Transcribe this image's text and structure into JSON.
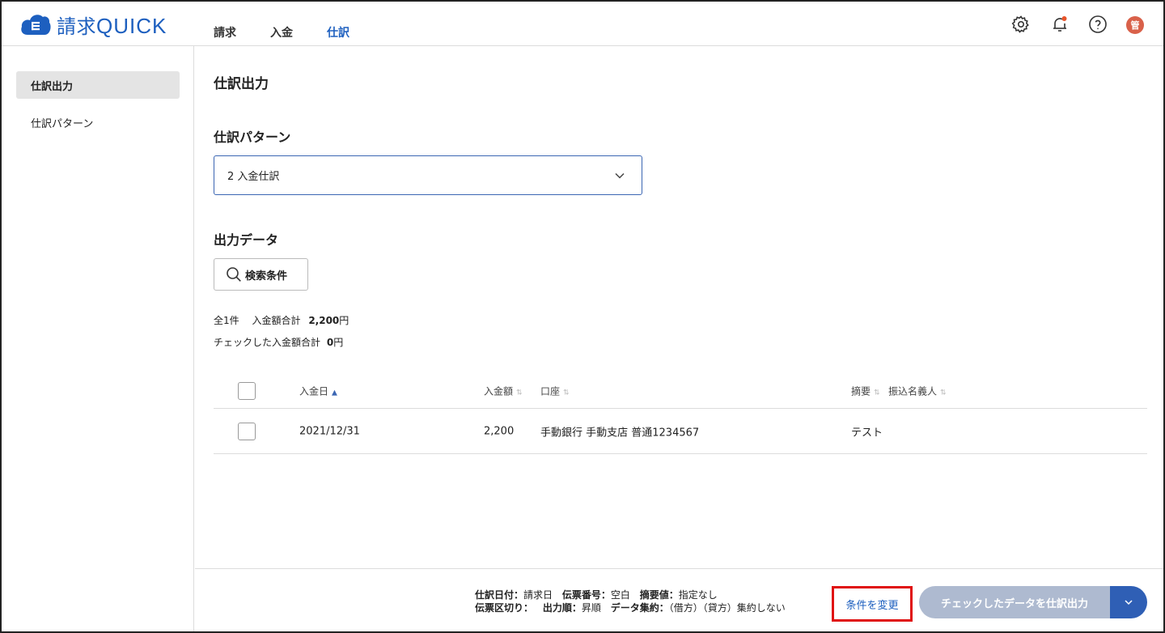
{
  "app": {
    "logo_main": "請求",
    "logo_sub": "QUICK"
  },
  "nav": {
    "items": [
      "請求",
      "入金",
      "仕訳"
    ]
  },
  "header": {
    "avatar_text": "管"
  },
  "sidebar": {
    "items": [
      "仕訳出力",
      "仕訳パターン"
    ]
  },
  "main": {
    "page_title": "仕訳出力",
    "pattern_section_title": "仕訳パターン",
    "pattern_selected": "2 入金仕訳",
    "output_section_title": "出力データ",
    "search_button_label": "検索条件",
    "summary": {
      "total_count": "全1件",
      "total_amount_label": "入金額合計",
      "total_amount_value": "2,200",
      "yen": "円",
      "checked_amount_label": "チェックした入金額合計",
      "checked_amount_value": "0"
    }
  },
  "table": {
    "columns": [
      "入金日",
      "入金額",
      "口座",
      "摘要",
      "振込名義人"
    ],
    "rows": [
      {
        "date": "2021/12/31",
        "amount": "2,200",
        "account": "手動銀行 手動支店 普通1234567",
        "memo": "テスト",
        "payer": ""
      }
    ]
  },
  "footer": {
    "line1": [
      {
        "label": "仕訳日付：",
        "value": "請求日"
      },
      {
        "label": "伝票番号：",
        "value": "空白"
      },
      {
        "label": "摘要値：",
        "value": "指定なし"
      }
    ],
    "line2": [
      {
        "label": "伝票区切り：",
        "value": ""
      },
      {
        "label": "出力順：",
        "value": "昇順"
      },
      {
        "label": "データ集約：",
        "value": "（借方）（貸方）集約しない"
      }
    ],
    "change_link": "条件を変更",
    "export_button": "チェックしたデータを仕訳出力"
  },
  "colors": {
    "brand": "#1d5fbf",
    "accent_button": "#2f5fb5",
    "disabled_button": "#aebad0",
    "highlight_border": "#e01010",
    "notification_dot": "#e8542a"
  }
}
